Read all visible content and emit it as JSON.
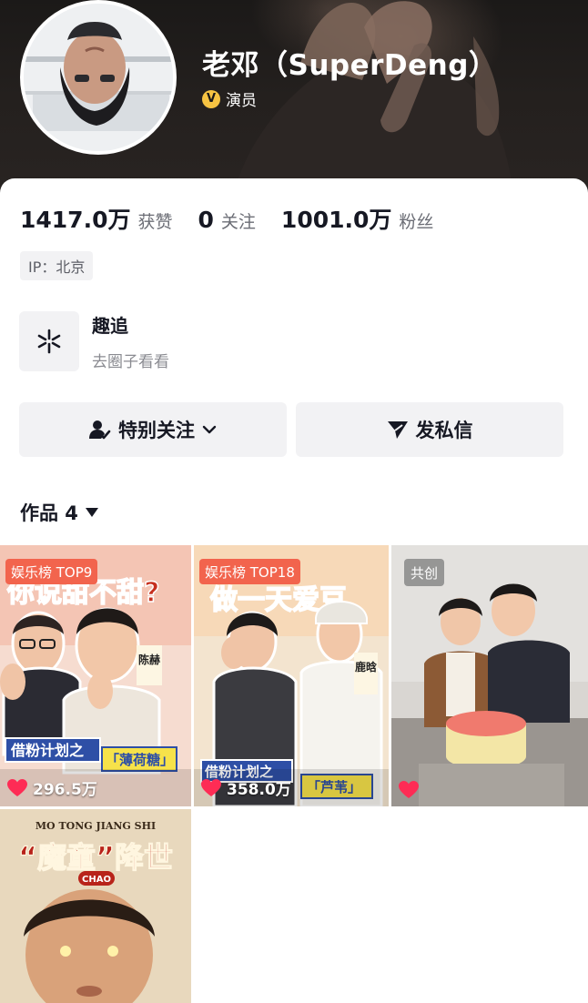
{
  "profile": {
    "nickname": "老邓（SuperDeng）",
    "verify_icon_text": "V",
    "verify_label": "演员",
    "verify_color": "#f6c342"
  },
  "stats": [
    {
      "value": "1417.0万",
      "label": "获赞"
    },
    {
      "value": "0",
      "label": "关注"
    },
    {
      "value": "1001.0万",
      "label": "粉丝"
    }
  ],
  "ip_location": "IP：北京",
  "circle": {
    "icon": "asterisk-icon",
    "title": "趣追",
    "subtitle": "去圈子看看"
  },
  "actions": {
    "follow_label": "特别关注",
    "follow_icon": "user-check-icon",
    "message_label": "发私信",
    "message_icon": "send-icon"
  },
  "works_tab": {
    "label": "作品 4"
  },
  "videos": [
    {
      "badge": "娱乐榜 TOP9",
      "likes": "296.5万",
      "liked": true
    },
    {
      "badge": "娱乐榜 TOP18",
      "likes": "358.0万",
      "liked": true
    },
    {
      "badge": "共创",
      "likes": "",
      "liked": true
    },
    {
      "badge": "",
      "likes": "",
      "liked": false
    }
  ],
  "thumbnail_text": {
    "v1_title": "你说甜不甜?",
    "v1_caption": "借粉计划之",
    "v1_sub": "「薄荷糖」",
    "v1_name": "陈赫",
    "v2_title": "做一天爱豆",
    "v2_caption": "借粉计划之",
    "v2_sub": "「芦苇」",
    "v2_name": "鹿晗",
    "v4_top": "MO TONG JIANG SHI",
    "v4_title": "“魔童”降世",
    "v4_tag": "CHAO"
  },
  "colors": {
    "accent_badge": "#f2644d",
    "heart": "#fe2c55"
  }
}
